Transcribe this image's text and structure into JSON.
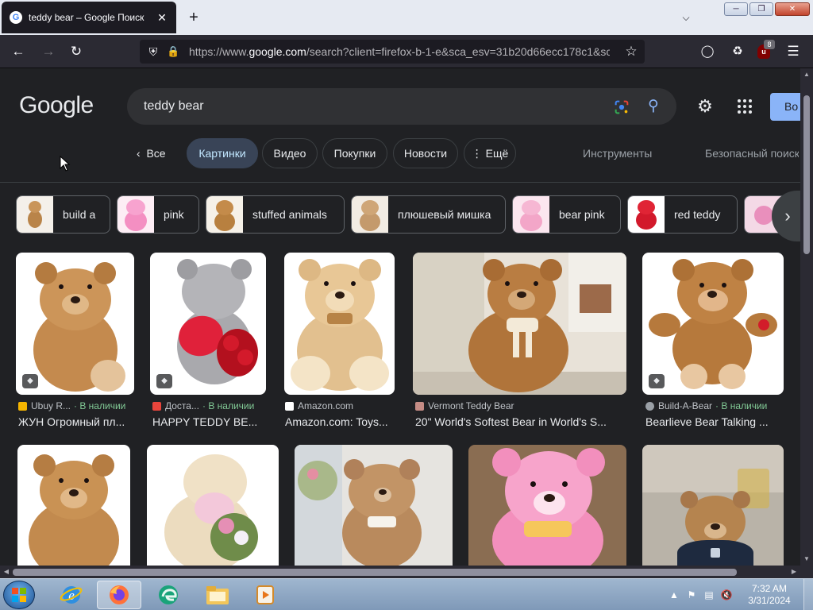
{
  "browser": {
    "tab_title": "teddy bear – Google Поиск",
    "tab_close": "✕",
    "new_tab": "+",
    "url_prefix": "https://www.",
    "url_domain": "google.com",
    "url_rest": "/search?client=firefox-b-1-e&sca_esv=31b20d66ecc178c1&sca_",
    "extension_badge": "8"
  },
  "google": {
    "logo": "Google",
    "query": "teddy bear",
    "signin_label": "Во",
    "back_label": "Все",
    "tabs": [
      {
        "label": "Картинки",
        "active": true
      },
      {
        "label": "Видео"
      },
      {
        "label": "Покупки"
      },
      {
        "label": "Новости"
      },
      {
        "label": "⋮ Ещё"
      }
    ],
    "tools_label": "Инструменты",
    "safesearch_label": "Безопасный поиск"
  },
  "chips": [
    {
      "label": "build a"
    },
    {
      "label": "pink"
    },
    {
      "label": "stuffed animals"
    },
    {
      "label": "плюшевый мишка"
    },
    {
      "label": "bear pink"
    },
    {
      "label": "red teddy"
    }
  ],
  "results": [
    {
      "source": "Ubuy R...",
      "stock": "· В наличии",
      "title": "ЖУН Огромный пл...",
      "icon_color": "#f4b400"
    },
    {
      "source": "Доста...",
      "stock": "· В наличии",
      "title": "HAPPY TEDDY BE...",
      "icon_color": "#e8453c"
    },
    {
      "source": "Amazon.com",
      "stock": "",
      "title": "Amazon.com: Toys...",
      "icon_color": "#ffffff"
    },
    {
      "source": "Vermont Teddy Bear",
      "stock": "",
      "title": "20\" World's Softest Bear in World's S...",
      "icon_color": "#c58c85"
    },
    {
      "source": "Build-A-Bear",
      "stock": "· В наличии",
      "title": "Bearlieve Bear Talking ...",
      "icon_color": "#9aa0a6"
    }
  ],
  "taskbar": {
    "time": "7:32 AM",
    "date": "3/31/2024"
  }
}
